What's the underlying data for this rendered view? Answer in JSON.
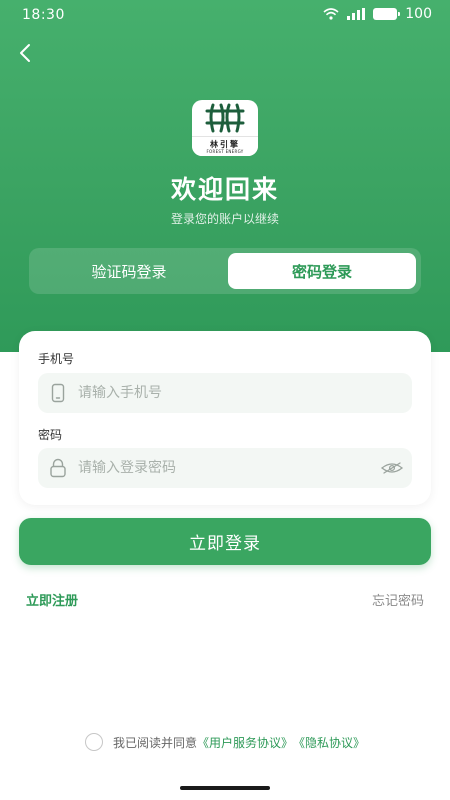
{
  "status_bar": {
    "time": "18:30",
    "battery": "100"
  },
  "logo": {
    "cn": "林引擎",
    "en": "FOREST ENERGY"
  },
  "header": {
    "title": "欢迎回来",
    "subtitle": "登录您的账户以继续"
  },
  "tabs": [
    {
      "label": "验证码登录",
      "active": false
    },
    {
      "label": "密码登录",
      "active": true
    }
  ],
  "form": {
    "phone_label": "手机号",
    "phone_placeholder": "请输入手机号",
    "phone_value": "",
    "password_label": "密码",
    "password_placeholder": "请输入登录密码",
    "password_value": ""
  },
  "login_button": "立即登录",
  "links": {
    "register": "立即注册",
    "forgot": "忘记密码"
  },
  "agreement": {
    "prefix": "我已阅读并同意",
    "user_agreement": "《用户服务协议》",
    "privacy": "《隐私协议》"
  },
  "colors": {
    "primary": "#3aa661",
    "accent_text": "#2e9a58"
  }
}
